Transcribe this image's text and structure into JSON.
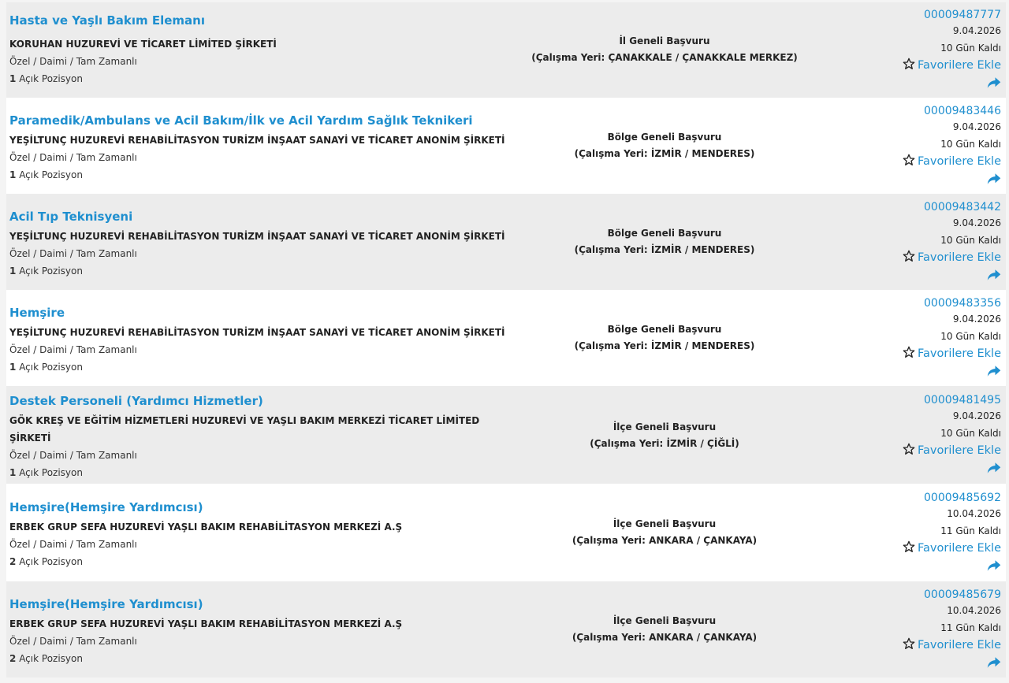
{
  "items": [
    {
      "title": "Hasta ve Yaşlı Bakım Elemanı",
      "company": "KORUHAN HUZUREVİ VE TİCARET LİMİTED ŞİRKETİ",
      "type": "Özel / Daimi / Tam Zamanlı",
      "count": "1",
      "count_label": "Açık Pozisyon",
      "scope": "İl Geneli Başvuru",
      "location": "(Çalışma Yeri: ÇANAKKALE / ÇANAKKALE MERKEZ)",
      "code": "00009487777",
      "date": "9.04.2026",
      "days_left": "10 Gün Kaldı",
      "fav_label": "Favorilere Ekle"
    },
    {
      "title": "Paramedik/Ambulans ve Acil Bakım/İlk ve Acil Yardım Sağlık Teknikeri",
      "company": "YEŞİLTUNÇ HUZUREVİ REHABİLİTASYON TURİZM İNŞAAT SANAYİ VE TİCARET ANONİM ŞİRKETİ",
      "type": "Özel / Daimi / Tam Zamanlı",
      "count": "1",
      "count_label": "Açık Pozisyon",
      "scope": "Bölge Geneli Başvuru",
      "location": "(Çalışma Yeri: İZMİR / MENDERES)",
      "code": "00009483446",
      "date": "9.04.2026",
      "days_left": "10 Gün Kaldı",
      "fav_label": "Favorilere Ekle"
    },
    {
      "title": "Acil Tıp Teknisyeni",
      "company": "YEŞİLTUNÇ HUZUREVİ REHABİLİTASYON TURİZM İNŞAAT SANAYİ VE TİCARET ANONİM ŞİRKETİ",
      "type": "Özel / Daimi / Tam Zamanlı",
      "count": "1",
      "count_label": "Açık Pozisyon",
      "scope": "Bölge Geneli Başvuru",
      "location": "(Çalışma Yeri: İZMİR / MENDERES)",
      "code": "00009483442",
      "date": "9.04.2026",
      "days_left": "10 Gün Kaldı",
      "fav_label": "Favorilere Ekle"
    },
    {
      "title": "Hemşire",
      "company": "YEŞİLTUNÇ HUZUREVİ REHABİLİTASYON TURİZM İNŞAAT SANAYİ VE TİCARET ANONİM ŞİRKETİ",
      "type": "Özel / Daimi / Tam Zamanlı",
      "count": "1",
      "count_label": "Açık Pozisyon",
      "scope": "Bölge Geneli Başvuru",
      "location": "(Çalışma Yeri: İZMİR / MENDERES)",
      "code": "00009483356",
      "date": "9.04.2026",
      "days_left": "10 Gün Kaldı",
      "fav_label": "Favorilere Ekle"
    },
    {
      "title": "Destek Personeli (Yardımcı Hizmetler)",
      "company": "GÖK KREŞ VE EĞİTİM HİZMETLERİ HUZUREVİ VE YAŞLI BAKIM MERKEZİ TİCARET LİMİTED ŞİRKETİ",
      "type": "Özel / Daimi / Tam Zamanlı",
      "count": "1",
      "count_label": "Açık Pozisyon",
      "scope": "İlçe Geneli Başvuru",
      "location": "(Çalışma Yeri: İZMİR / ÇİĞLİ)",
      "code": "00009481495",
      "date": "9.04.2026",
      "days_left": "10 Gün Kaldı",
      "fav_label": "Favorilere Ekle"
    },
    {
      "title": "Hemşire(Hemşire Yardımcısı)",
      "company": "ERBEK GRUP SEFA HUZUREVİ YAŞLI BAKIM REHABİLİTASYON MERKEZİ A.Ş",
      "type": "Özel / Daimi / Tam Zamanlı",
      "count": "2",
      "count_label": "Açık Pozisyon",
      "scope": "İlçe Geneli Başvuru",
      "location": "(Çalışma Yeri: ANKARA / ÇANKAYA)",
      "code": "00009485692",
      "date": "10.04.2026",
      "days_left": "11 Gün Kaldı",
      "fav_label": "Favorilere Ekle"
    },
    {
      "title": "Hemşire(Hemşire Yardımcısı)",
      "company": "ERBEK GRUP SEFA HUZUREVİ YAŞLI BAKIM REHABİLİTASYON MERKEZİ A.Ş",
      "type": "Özel / Daimi / Tam Zamanlı",
      "count": "2",
      "count_label": "Açık Pozisyon",
      "scope": "İlçe Geneli Başvuru",
      "location": "(Çalışma Yeri: ANKARA / ÇANKAYA)",
      "code": "00009485679",
      "date": "10.04.2026",
      "days_left": "11 Gün Kaldı",
      "fav_label": "Favorilere Ekle"
    }
  ],
  "icons": {
    "favorite": "star-outline-icon",
    "share": "share-arrow-icon"
  },
  "colors": {
    "link": "#1f8fcf",
    "row_alt": "#ececec",
    "row": "#ffffff"
  }
}
